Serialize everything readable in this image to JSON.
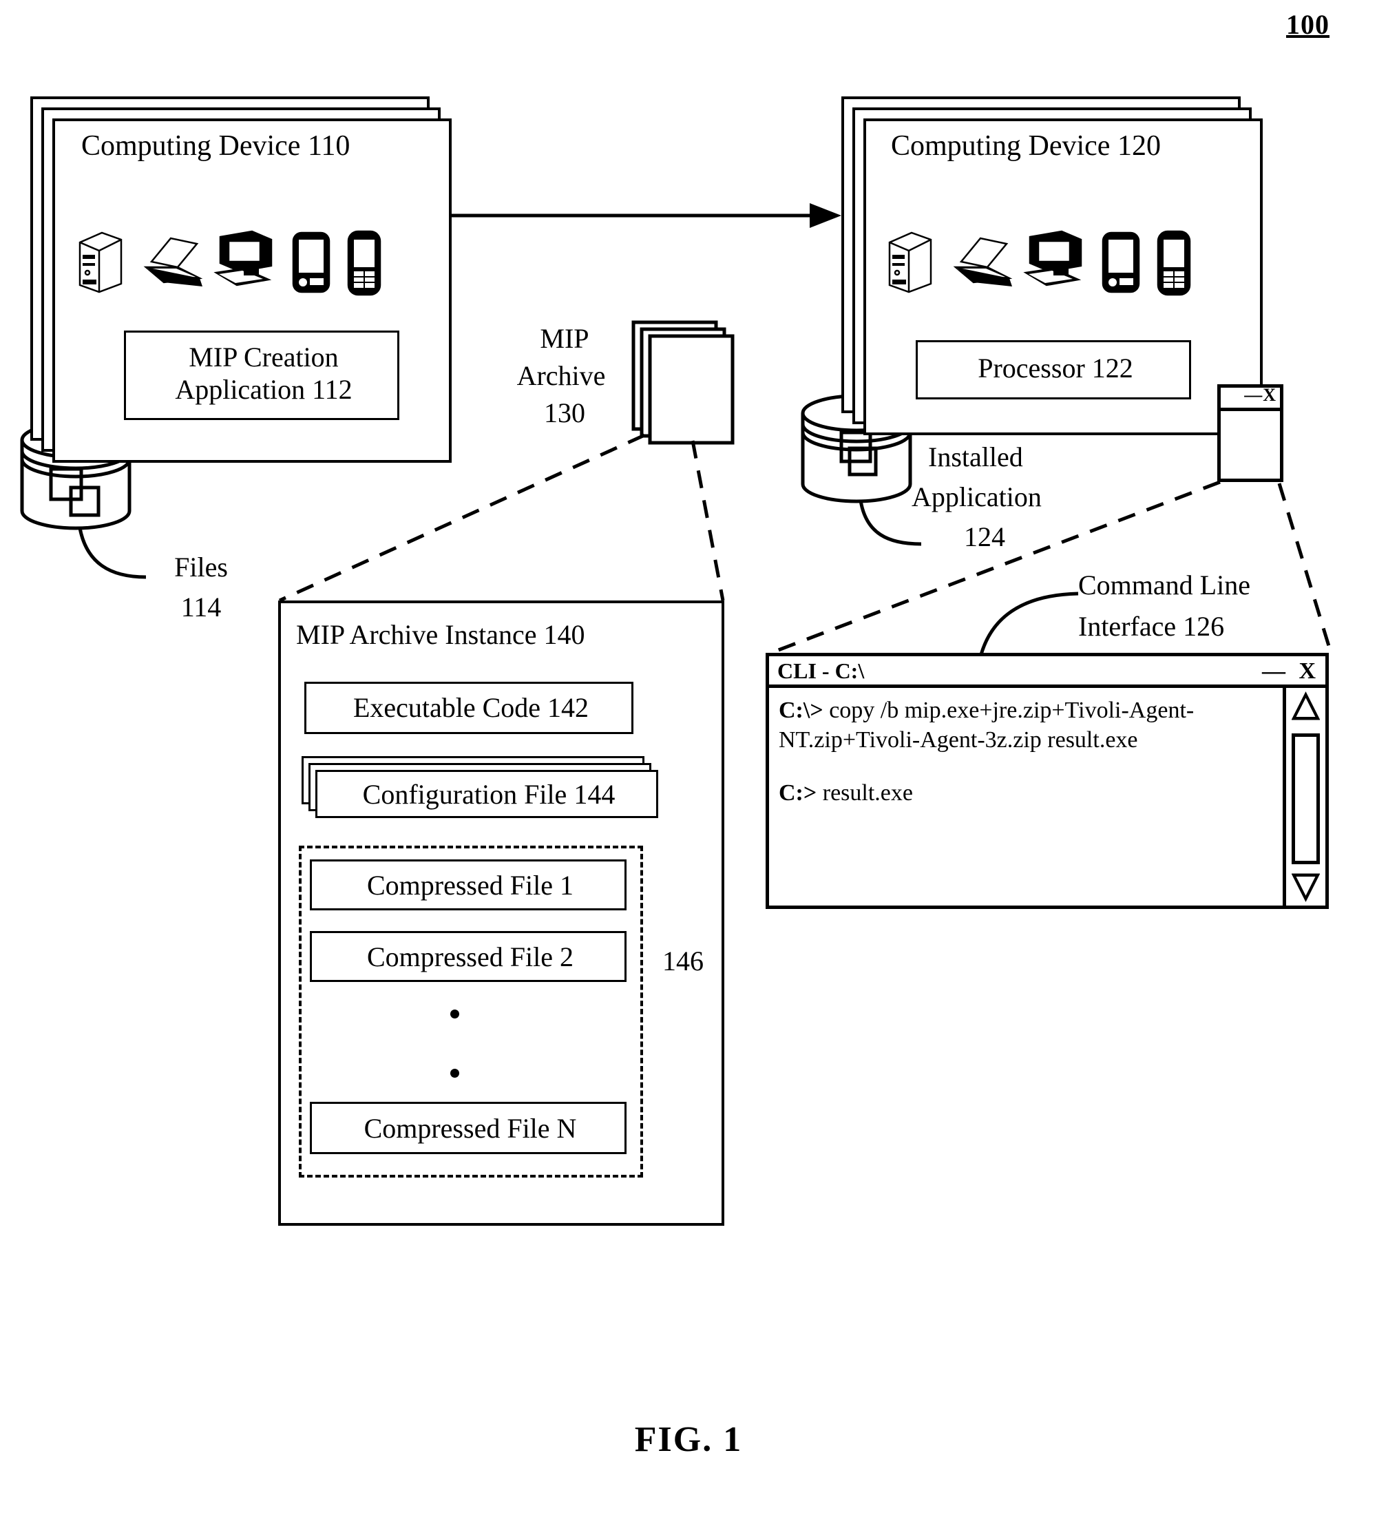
{
  "figure": {
    "number": "100",
    "caption": "FIG. 1"
  },
  "device_left": {
    "title": "Computing Device 110",
    "icons": [
      "server-tower-icon",
      "laptop-icon",
      "desktop-computer-icon",
      "pda-icon",
      "mobile-phone-icon"
    ],
    "module": "MIP Creation Application 112",
    "storage": {
      "icon": "database-cylinder-icon",
      "label_line1": "Files",
      "label_line2": "114"
    }
  },
  "device_right": {
    "title": "Computing Device 120",
    "icons": [
      "server-tower-icon",
      "laptop-icon",
      "desktop-computer-icon",
      "pda-icon",
      "mobile-phone-icon"
    ],
    "module": "Processor 122",
    "storage": {
      "icon": "database-cylinder-icon",
      "label_line1": "Installed",
      "label_line2": "Application",
      "label_line3": "124"
    },
    "mini_window": {
      "icon": "window-glyph-icon",
      "minimize": "—",
      "close": "X"
    }
  },
  "transfer": {
    "icon": "document-stack-icon",
    "label_line1": "MIP",
    "label_line2": "Archive",
    "label_line3": "130",
    "arrow": "arrow-right-icon"
  },
  "archive_instance": {
    "title": "MIP Archive Instance 140",
    "executable": "Executable Code 142",
    "configuration": "Configuration File 144",
    "compressed_group_ref": "146",
    "compressed_files": [
      "Compressed File 1",
      "Compressed File 2",
      "Compressed File N"
    ],
    "ellipsis_dots": 2
  },
  "cli": {
    "callout_line1": "Command Line",
    "callout_line2": "Interface 126",
    "title": "CLI - C:\\",
    "minimize_label": "—",
    "close_label": "X",
    "lines": [
      {
        "prompt": "C:\\>",
        "text": " copy /b mip.exe+jre.zip+Tivoli-Agent-NT.zip+Tivoli-Agent-3z.zip result.exe"
      },
      {
        "prompt": "",
        "text": ""
      },
      {
        "prompt": "C:>",
        "text": " result.exe"
      }
    ],
    "scrollbar": {
      "up_icon": "triangle-up-icon",
      "down_icon": "triangle-down-icon",
      "thumb": "scroll-thumb"
    }
  },
  "colors": {
    "ink": "#000000",
    "paper": "#ffffff"
  }
}
